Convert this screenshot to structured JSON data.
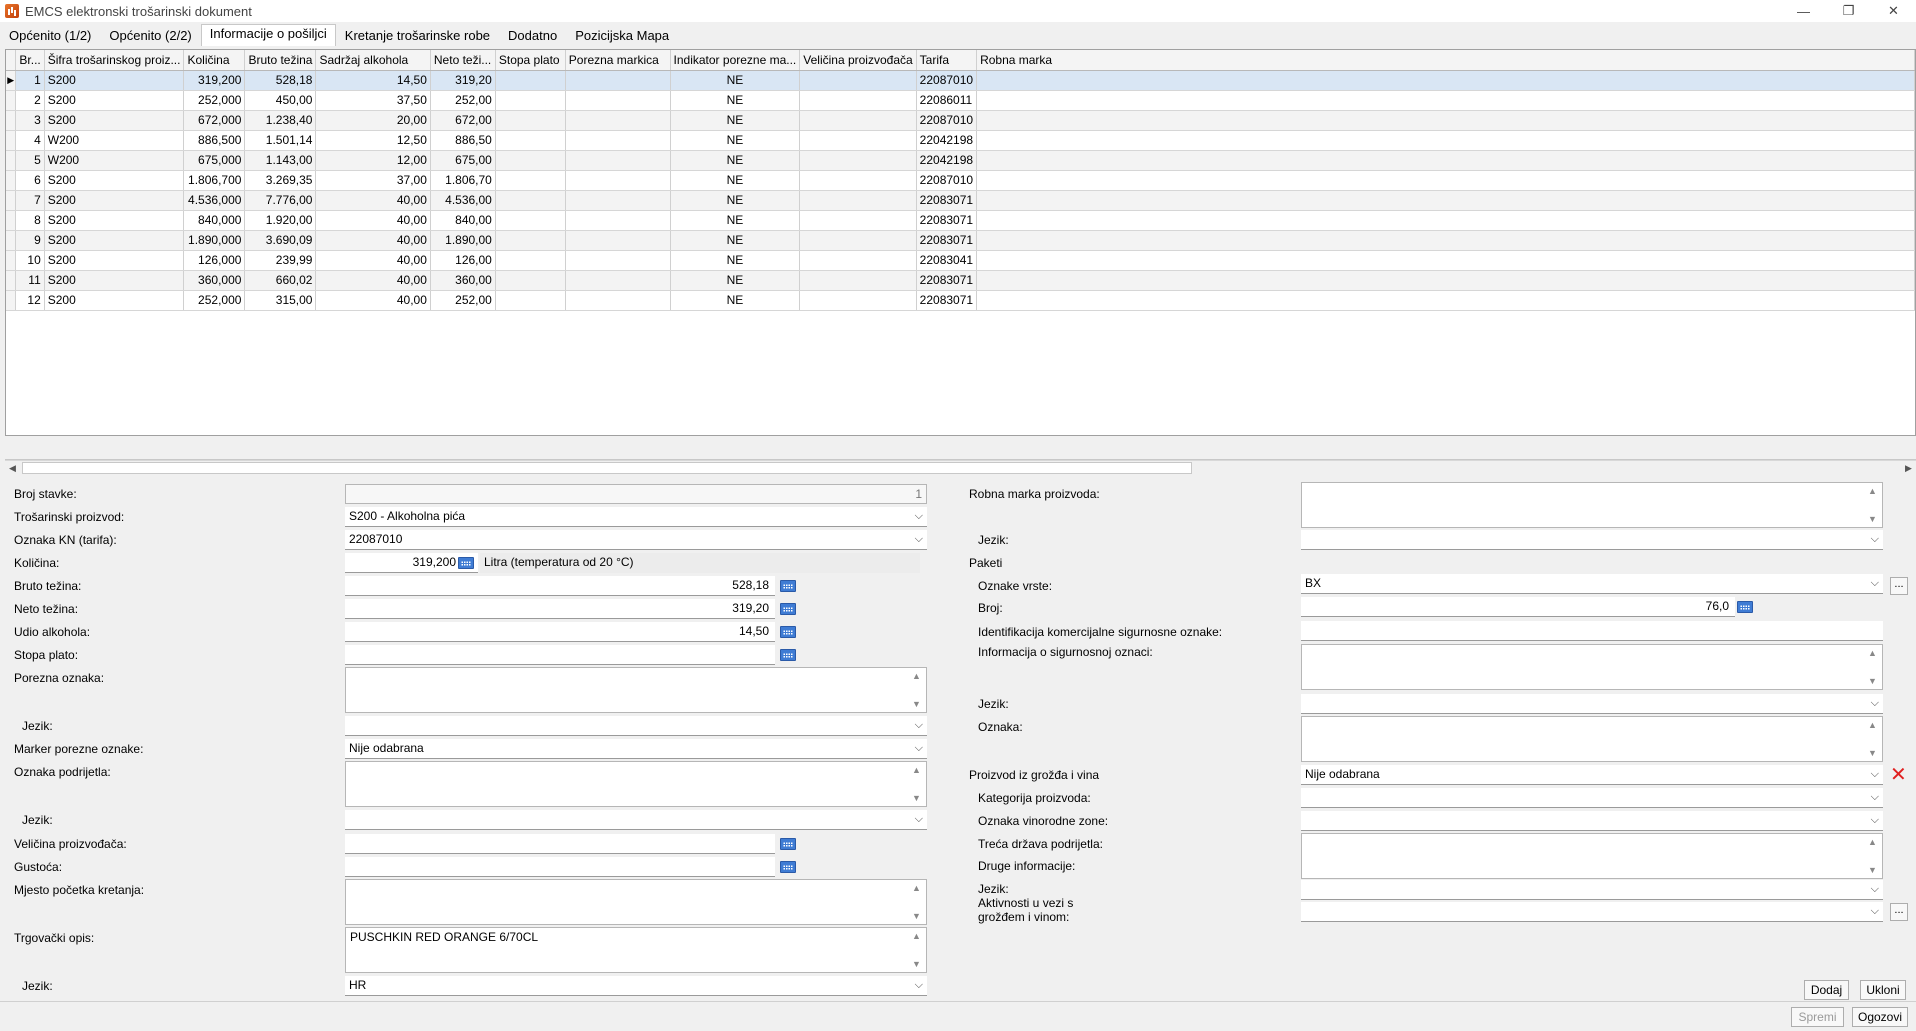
{
  "window": {
    "title": "EMCS elektronski trošarinski dokument",
    "minimize": "—",
    "maximize": "❐",
    "close": "✕"
  },
  "tabs": [
    "Općenito (1/2)",
    "Općenito (2/2)",
    "Informacije o pošiljci",
    "Kretanje trošarinske robe",
    "Dodatno",
    "Pozicijska Mapa"
  ],
  "grid": {
    "columns": [
      "Br...",
      "Šifra trošarinskog proiz...",
      "Količina",
      "Bruto težina",
      "Sadržaj alkohola",
      "Neto teži...",
      "Stopa plato",
      "Porezna markica",
      "Indikator porezne ma...",
      "Veličina proizvođača",
      "Tarifa",
      "Robna marka"
    ],
    "rows": [
      [
        "1",
        "S200",
        "319,200",
        "528,18",
        "14,50",
        "319,20",
        "",
        "",
        "NE",
        "",
        "22087010",
        ""
      ],
      [
        "2",
        "S200",
        "252,000",
        "450,00",
        "37,50",
        "252,00",
        "",
        "",
        "NE",
        "",
        "22086011",
        ""
      ],
      [
        "3",
        "S200",
        "672,000",
        "1.238,40",
        "20,00",
        "672,00",
        "",
        "",
        "NE",
        "",
        "22087010",
        ""
      ],
      [
        "4",
        "W200",
        "886,500",
        "1.501,14",
        "12,50",
        "886,50",
        "",
        "",
        "NE",
        "",
        "22042198",
        ""
      ],
      [
        "5",
        "W200",
        "675,000",
        "1.143,00",
        "12,00",
        "675,00",
        "",
        "",
        "NE",
        "",
        "22042198",
        ""
      ],
      [
        "6",
        "S200",
        "1.806,700",
        "3.269,35",
        "37,00",
        "1.806,70",
        "",
        "",
        "NE",
        "",
        "22087010",
        ""
      ],
      [
        "7",
        "S200",
        "4.536,000",
        "7.776,00",
        "40,00",
        "4.536,00",
        "",
        "",
        "NE",
        "",
        "22083071",
        ""
      ],
      [
        "8",
        "S200",
        "840,000",
        "1.920,00",
        "40,00",
        "840,00",
        "",
        "",
        "NE",
        "",
        "22083071",
        ""
      ],
      [
        "9",
        "S200",
        "1.890,000",
        "3.690,09",
        "40,00",
        "1.890,00",
        "",
        "",
        "NE",
        "",
        "22083071",
        ""
      ],
      [
        "10",
        "S200",
        "126,000",
        "239,99",
        "40,00",
        "126,00",
        "",
        "",
        "NE",
        "",
        "22083041",
        ""
      ],
      [
        "11",
        "S200",
        "360,000",
        "660,02",
        "40,00",
        "360,00",
        "",
        "",
        "NE",
        "",
        "22083071",
        ""
      ],
      [
        "12",
        "S200",
        "252,000",
        "315,00",
        "40,00",
        "252,00",
        "",
        "",
        "NE",
        "",
        "22083071",
        ""
      ]
    ]
  },
  "left": {
    "broj_stavke": {
      "label": "Broj stavke:",
      "value": "1"
    },
    "trosarinski": {
      "label": "Trošarinski proizvod:",
      "value": "S200 - Alkoholna pića"
    },
    "oznaka_kn": {
      "label": "Oznaka KN (tarifa):",
      "value": "22087010"
    },
    "kolicina": {
      "label": "Količina:",
      "value": "319,200",
      "unit": "Litra (temperatura od 20 °C)"
    },
    "bruto": {
      "label": "Bruto težina:",
      "value": "528,18"
    },
    "neto": {
      "label": "Neto težina:",
      "value": "319,20"
    },
    "udio": {
      "label": "Udio alkohola:",
      "value": "14,50"
    },
    "stopa": {
      "label": "Stopa plato:",
      "value": ""
    },
    "porezna": {
      "label": "Porezna oznaka:",
      "value": ""
    },
    "jezik1": {
      "label": "Jezik:",
      "value": ""
    },
    "marker": {
      "label": "Marker porezne oznake:",
      "value": "Nije odabrana"
    },
    "podrijetlo": {
      "label": "Oznaka podrijetla:",
      "value": ""
    },
    "jezik2": {
      "label": "Jezik:",
      "value": ""
    },
    "velicina": {
      "label": "Veličina proizvođača:",
      "value": ""
    },
    "gustoca": {
      "label": "Gustoća:",
      "value": ""
    },
    "mjesto": {
      "label": "Mjesto početka kretanja:",
      "value": ""
    },
    "opis": {
      "label": "Trgovački opis:",
      "value": "PUSCHKIN RED ORANGE 6/70CL"
    },
    "jezik3": {
      "label": "Jezik:",
      "value": "HR"
    }
  },
  "right": {
    "robna": {
      "label": "Robna marka proizvoda:",
      "value": ""
    },
    "jezik1": {
      "label": "Jezik:",
      "value": ""
    },
    "paketi": {
      "label": "Paketi"
    },
    "oznake_vrste": {
      "label": "Oznake vrste:",
      "value": "BX"
    },
    "broj": {
      "label": "Broj:",
      "value": "76,0"
    },
    "ident": {
      "label": "Identifikacija komercijalne sigurnosne oznake:",
      "value": ""
    },
    "info_sig": {
      "label": "Informacija o sigurnosnoj oznaci:",
      "value": ""
    },
    "jezik2": {
      "label": "Jezik:",
      "value": ""
    },
    "oznaka": {
      "label": "Oznaka:",
      "value": ""
    },
    "grozde": {
      "label": "Proizvod iz grožđa i vina",
      "value": "Nije odabrana"
    },
    "kategorija": {
      "label": "Kategorija proizvoda:",
      "value": ""
    },
    "vinorodne": {
      "label": "Oznaka vinorodne zone:",
      "value": ""
    },
    "treca": {
      "label": "Treća država podrijetla:",
      "value": ""
    },
    "druge": {
      "label": "Druge informacije:",
      "value": ""
    },
    "jezik3": {
      "label": "Jezik:",
      "value": ""
    },
    "aktivnosti": {
      "label1": "Aktivnosti u vezi s",
      "label2": "grožđem i vinom:",
      "value": ""
    }
  },
  "buttons": {
    "dodaj": "Dodaj",
    "ukloni": "Ukloni",
    "spremi": "Spremi",
    "ogozovi": "Ogozovi",
    "dots": "..."
  },
  "icons": {
    "chevron": "⌵",
    "up": "▲",
    "down": "▼",
    "left": "◀",
    "right": "▶",
    "row_pointer": "▶",
    "remove": "✕"
  }
}
